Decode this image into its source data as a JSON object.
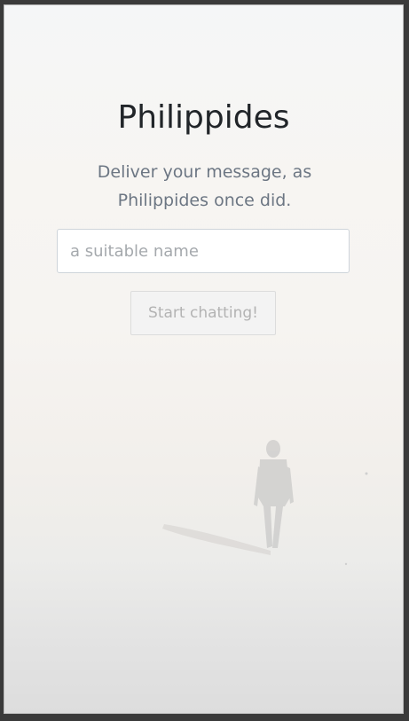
{
  "app": {
    "title": "Philippides",
    "tagline": "Deliver your message, as Philippides once did."
  },
  "form": {
    "name_placeholder": "a suitable name",
    "name_value": "",
    "start_label": "Start chatting!"
  },
  "background": {
    "image_subject": "person-walking-in-fog"
  }
}
